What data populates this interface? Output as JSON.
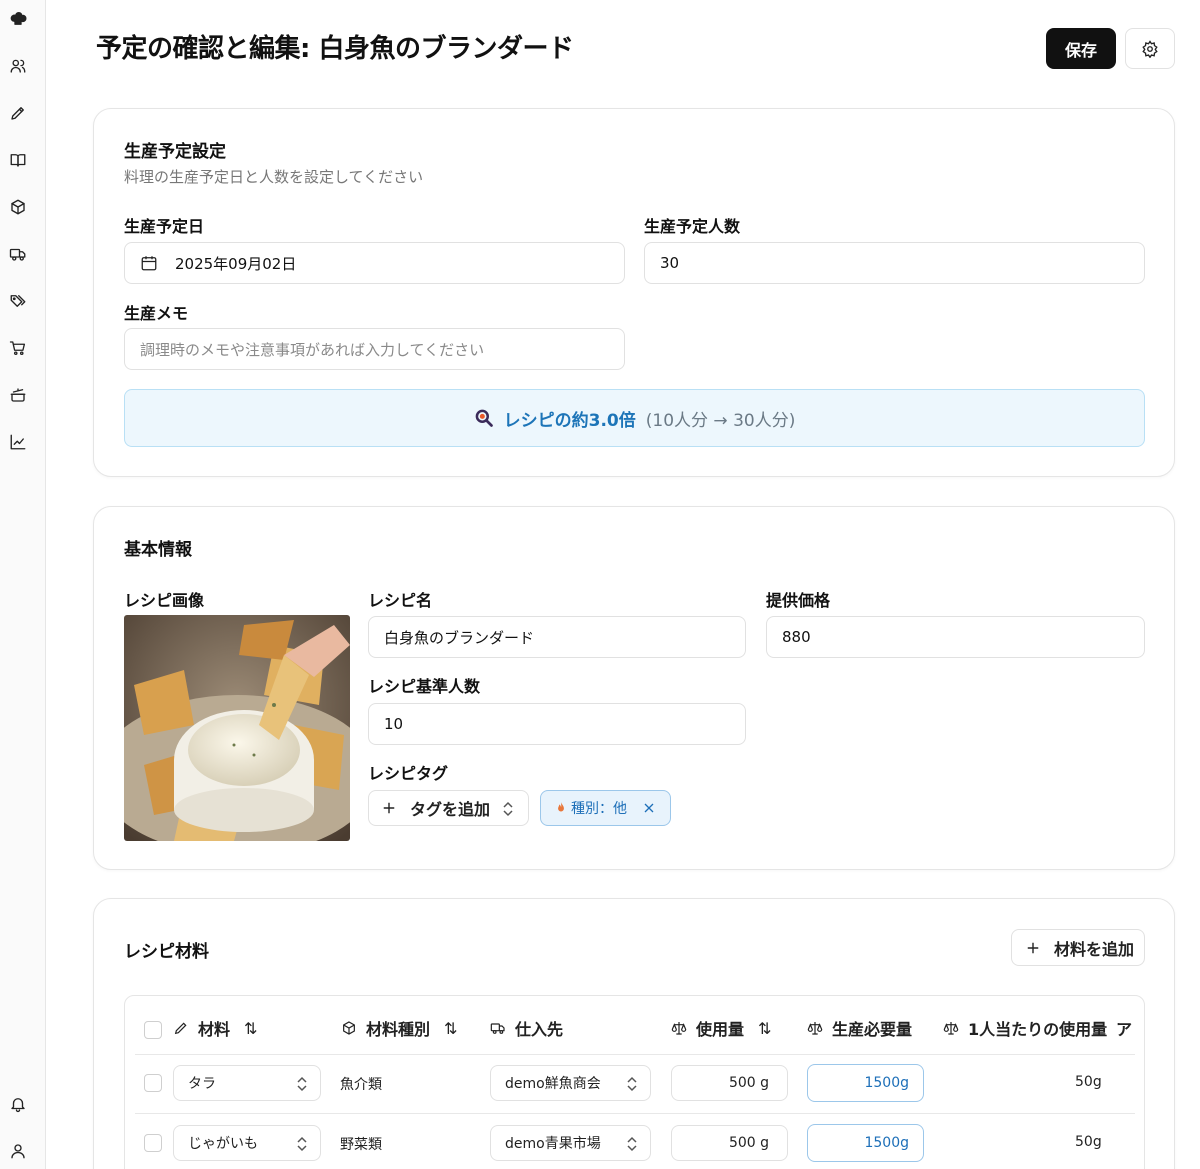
{
  "page": {
    "title": "予定の確認と編集: 白身魚のブランダード",
    "save_label": "保存"
  },
  "sidebar": {
    "icons": [
      "chef-hat-icon",
      "users-icon",
      "pen-icon",
      "book-icon",
      "box-icon",
      "truck-icon",
      "tags-icon",
      "cart-icon",
      "pot-icon",
      "chart-icon",
      "bell-icon",
      "user-icon"
    ]
  },
  "production": {
    "title": "生産予定設定",
    "subtitle": "料理の生産予定日と人数を設定してください",
    "date_label": "生産予定日",
    "date_value": "2025年09月02日",
    "people_label": "生産予定人数",
    "people_value": "30",
    "memo_label": "生産メモ",
    "memo_placeholder": "調理時のメモや注意事項があれば入力してください",
    "scale_main": "レシピの約3.0倍",
    "scale_sub": "(10人分 → 30人分)"
  },
  "basic": {
    "title": "基本情報",
    "image_label": "レシピ画像",
    "name_label": "レシピ名",
    "name_value": "白身魚のブランダード",
    "price_label": "提供価格",
    "price_value": "880",
    "base_people_label": "レシピ基準人数",
    "base_people_value": "10",
    "tags_label": "レシピタグ",
    "add_tag_label": "タグを追加",
    "tag_chip": "種別：他"
  },
  "materials": {
    "title": "レシピ材料",
    "add_label": "材料を追加",
    "columns": [
      "材料",
      "材料種別",
      "仕入先",
      "使用量",
      "生産必要量",
      "1人当たりの使用量",
      "ア"
    ],
    "rows": [
      {
        "name": "タラ",
        "category": "魚介類",
        "supplier": "demo鮮魚商会",
        "amount": "500 g",
        "required": "1500g",
        "per_person": "50g"
      },
      {
        "name": "じゃがいも",
        "category": "野菜類",
        "supplier": "demo青果市場",
        "amount": "500 g",
        "required": "1500g",
        "per_person": "50g"
      }
    ]
  },
  "colors": {
    "accent_blue": "#1d75b8",
    "banner_bg": "#edf7fd",
    "primary_button": "#111111"
  }
}
